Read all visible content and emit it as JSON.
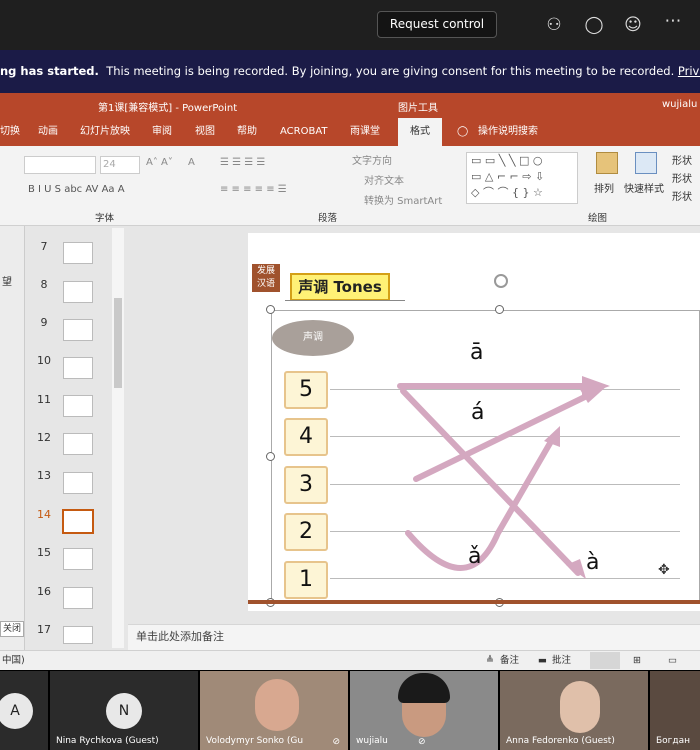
{
  "teams_bar": {
    "request_control": "Request control"
  },
  "banner": {
    "bold_text": "ng has started.",
    "text": "This meeting is being recorded. By joining, you are giving consent for this meeting to be recorded.",
    "link": "Privacy policy"
  },
  "powerpoint": {
    "title": "第1课[兼容模式]  -  PowerPoint",
    "picture_tools": "图片工具",
    "user": "wujialu",
    "tabs": [
      "切换",
      "动画",
      "幻灯片放映",
      "审阅",
      "视图",
      "帮助",
      "ACROBAT",
      "雨课堂",
      "格式"
    ],
    "tell_me": "操作说明搜索",
    "font_size": "24",
    "groups": {
      "font": "字体",
      "paragraph": "段落",
      "drawing": "绘图"
    },
    "ribbon_items": {
      "text_dir": "文字方向",
      "align_text": "对齐文本",
      "smartart": "转换为 SmartArt",
      "arrange": "排列",
      "quick_styles": "快速样式",
      "shape_fill": "形状",
      "shape_outline": "形状",
      "shape_effects": "形状"
    },
    "left_strip_label": "望",
    "close_label": "关闭",
    "slides": [
      {
        "num": "7"
      },
      {
        "num": "8"
      },
      {
        "num": "9"
      },
      {
        "num": "10"
      },
      {
        "num": "11"
      },
      {
        "num": "12"
      },
      {
        "num": "13"
      },
      {
        "num": "14"
      },
      {
        "num": "15"
      },
      {
        "num": "16"
      },
      {
        "num": "17"
      }
    ],
    "active_slide": "14",
    "notes_placeholder": "单击此处添加备注",
    "status": {
      "language": "中国)",
      "notes": "备注",
      "comments": "批注"
    }
  },
  "slide": {
    "badge": "发展\n汉语",
    "title": "声调 Tones",
    "oval_label": "声调",
    "levels": [
      "5",
      "4",
      "3",
      "2",
      "1"
    ],
    "tones": {
      "first": "ā",
      "second": "á",
      "third": "ǎ",
      "fourth": "à"
    },
    "arrow_color": "#d4a8c0"
  },
  "participants": [
    {
      "name": "",
      "initial": "A"
    },
    {
      "name": "Nina Rychkova (Guest)",
      "initial": "N"
    },
    {
      "name": "Volodymyr Sonko (Gu"
    },
    {
      "name": "wujialu"
    },
    {
      "name": "Anna Fedorenko (Guest)"
    },
    {
      "name": "Богдан"
    }
  ]
}
